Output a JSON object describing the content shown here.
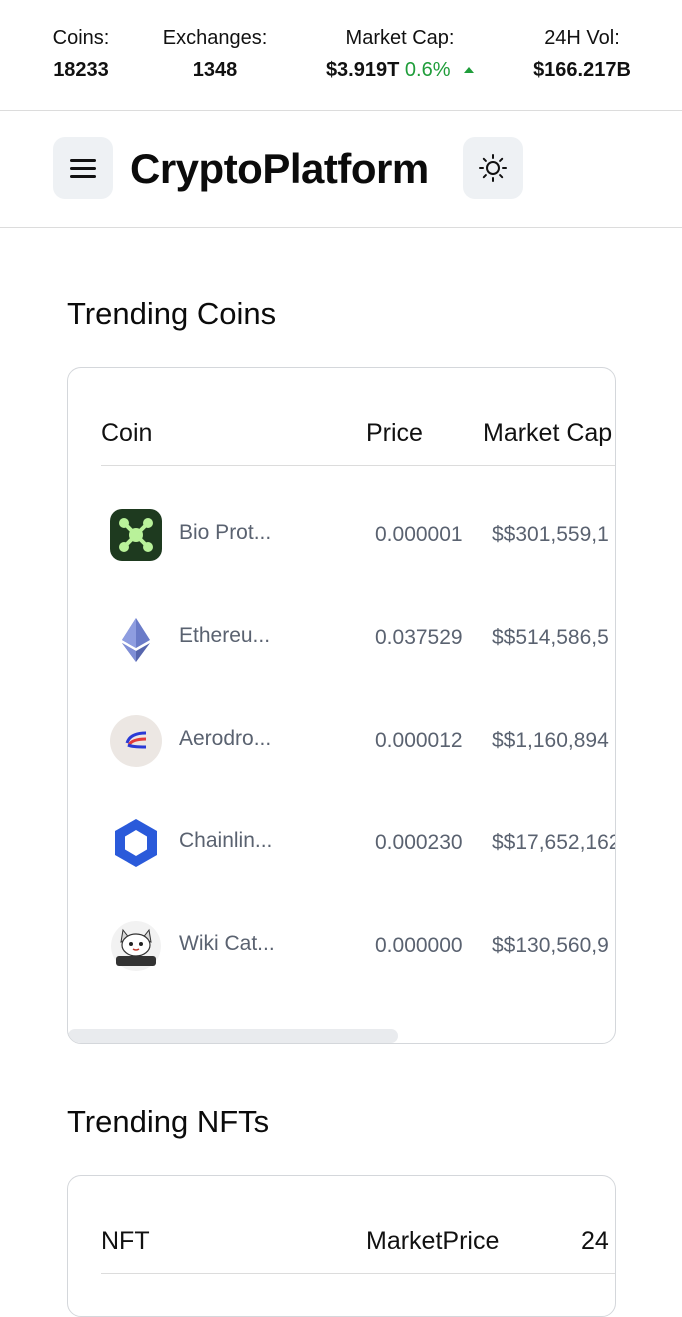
{
  "stats": {
    "coins_label": "Coins:",
    "coins_value": "18233",
    "exchanges_label": "Exchanges:",
    "exchanges_value": "1348",
    "mcap_label": "Market Cap:",
    "mcap_value": "$3.919T",
    "mcap_change": "0.6%",
    "vol_label": "24H Vol:",
    "vol_value": "$166.217B",
    "change_color": "#1f9d3a"
  },
  "header": {
    "brand": "CryptoPlatform",
    "menu_icon": "hamburger-icon",
    "theme_icon": "sun-icon"
  },
  "trending_coins": {
    "title": "Trending Coins",
    "columns": [
      "Coin",
      "Price",
      "Market Cap"
    ],
    "rows": [
      {
        "name": "Bio Prot...",
        "price": "0.000001",
        "market_cap": "$$301,559,1",
        "icon": "bio-protocol-icon"
      },
      {
        "name": "Ethereu...",
        "price": "0.037529",
        "market_cap": "$$514,586,5",
        "icon": "ethereum-icon"
      },
      {
        "name": "Aerodro...",
        "price": "0.000012",
        "market_cap": "$$1,160,894",
        "icon": "aerodrome-icon"
      },
      {
        "name": "Chainlin...",
        "price": "0.000230",
        "market_cap": "$$17,652,162",
        "icon": "chainlink-icon"
      },
      {
        "name": "Wiki Cat...",
        "price": "0.000000",
        "market_cap": "$$130,560,9",
        "icon": "wiki-cat-icon"
      }
    ]
  },
  "trending_nfts": {
    "title": "Trending NFTs",
    "columns": [
      "NFT",
      "MarketPrice",
      "24"
    ]
  }
}
